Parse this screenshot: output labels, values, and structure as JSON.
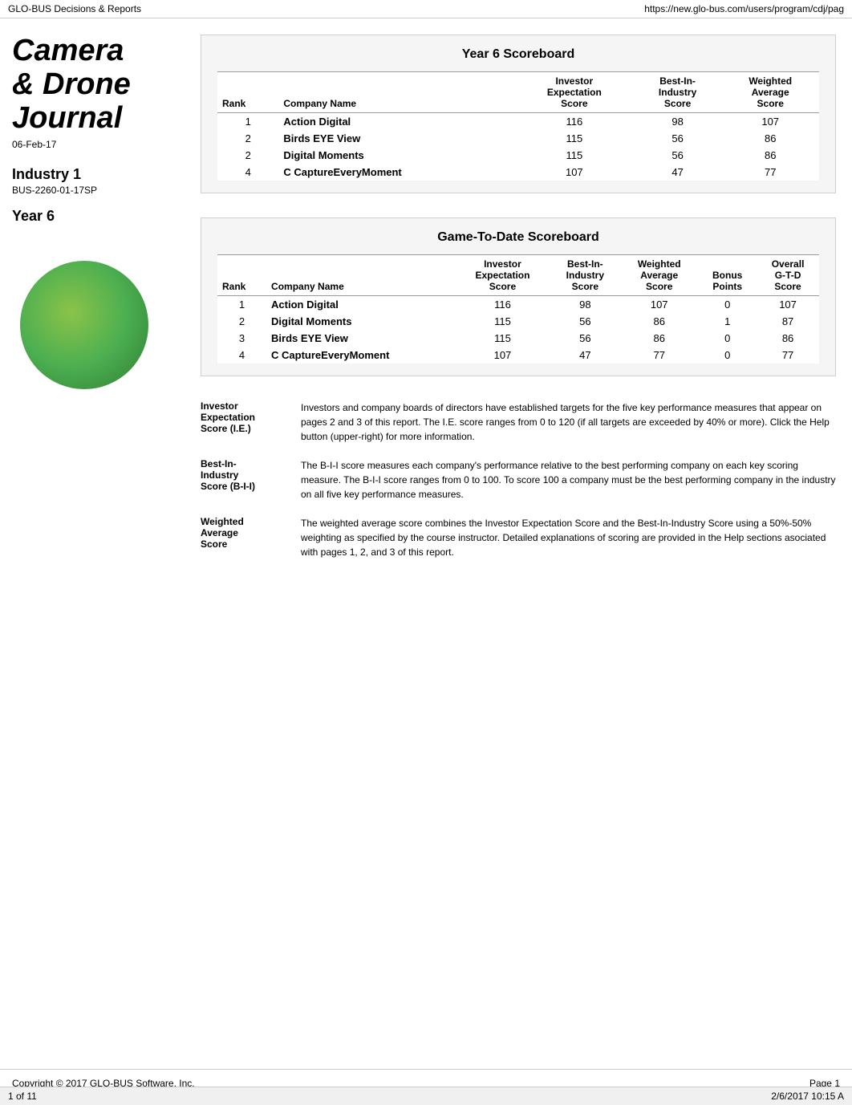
{
  "topbar": {
    "left": "GLO-BUS Decisions & Reports",
    "right": "https://new.glo-bus.com/users/program/cdj/pag"
  },
  "sidebar": {
    "logo_line1": "Camera",
    "logo_line2": "& Drone",
    "logo_line3": "Journal",
    "date": "06-Feb-17",
    "industry_label": "Industry 1",
    "bus_code": "BUS-2260-01-17SP",
    "year_label": "Year 6"
  },
  "year6_scoreboard": {
    "title": "Year 6 Scoreboard",
    "columns": {
      "rank": "Rank",
      "company": "Company Name",
      "investor_score": "Investor Expectation Score",
      "best_in_industry": "Best-In- Industry Score",
      "weighted_avg": "Weighted Average Score"
    },
    "rows": [
      {
        "rank": "1",
        "company": "Action Digital",
        "investor": "116",
        "best_in": "98",
        "weighted": "107"
      },
      {
        "rank": "2",
        "company": "Birds EYE View",
        "investor": "115",
        "best_in": "56",
        "weighted": "86"
      },
      {
        "rank": "2",
        "company": "Digital Moments",
        "investor": "115",
        "best_in": "56",
        "weighted": "86"
      },
      {
        "rank": "4",
        "company": "C CaptureEveryMoment",
        "investor": "107",
        "best_in": "47",
        "weighted": "77"
      }
    ]
  },
  "gtd_scoreboard": {
    "title": "Game-To-Date Scoreboard",
    "columns": {
      "rank": "Rank",
      "company": "Company Name",
      "investor_score": "Investor Expectation Score",
      "best_in_industry": "Best-In- Industry Score",
      "weighted_avg": "Weighted Average Score",
      "bonus_points": "Bonus Points",
      "overall_gtd": "Overall G-T-D Score"
    },
    "rows": [
      {
        "rank": "1",
        "company": "Action Digital",
        "investor": "116",
        "best_in": "98",
        "weighted": "107",
        "bonus": "0",
        "overall": "107"
      },
      {
        "rank": "2",
        "company": "Digital Moments",
        "investor": "115",
        "best_in": "56",
        "weighted": "86",
        "bonus": "1",
        "overall": "87"
      },
      {
        "rank": "3",
        "company": "Birds EYE View",
        "investor": "115",
        "best_in": "56",
        "weighted": "86",
        "bonus": "0",
        "overall": "86"
      },
      {
        "rank": "4",
        "company": "C CaptureEveryMoment",
        "investor": "107",
        "best_in": "47",
        "weighted": "77",
        "bonus": "0",
        "overall": "77"
      }
    ]
  },
  "descriptions": [
    {
      "term": "Investor Expectation Score (I.E.)",
      "definition": "Investors and company boards of directors have established targets for the five key performance measures that appear on pages 2 and 3 of this report. The I.E. score ranges from 0 to 120 (if all targets are exceeded by 40% or more). Click the Help button (upper-right) for more information."
    },
    {
      "term": "Best-In- Industry Score (B-I-I)",
      "definition": "The B-I-I score measures each company's performance relative to the best performing company on each key scoring measure. The B-I-I score ranges from 0 to 100. To score 100 a company must be the best performing company in the industry on all five key performance measures."
    },
    {
      "term": "Weighted Average Score",
      "definition": "The weighted average score combines the Investor Expectation Score and the Best-In-Industry Score using a 50%-50% weighting as specified by the course instructor. Detailed explanations of scoring are provided in the Help sections asociated with pages 1, 2, and 3 of this report."
    }
  ],
  "footer": {
    "copyright": "Copyright © 2017 GLO-BUS Software, Inc.",
    "page": "Page 1"
  },
  "pagination": {
    "left": "1 of 11",
    "right": "2/6/2017 10:15 A"
  }
}
